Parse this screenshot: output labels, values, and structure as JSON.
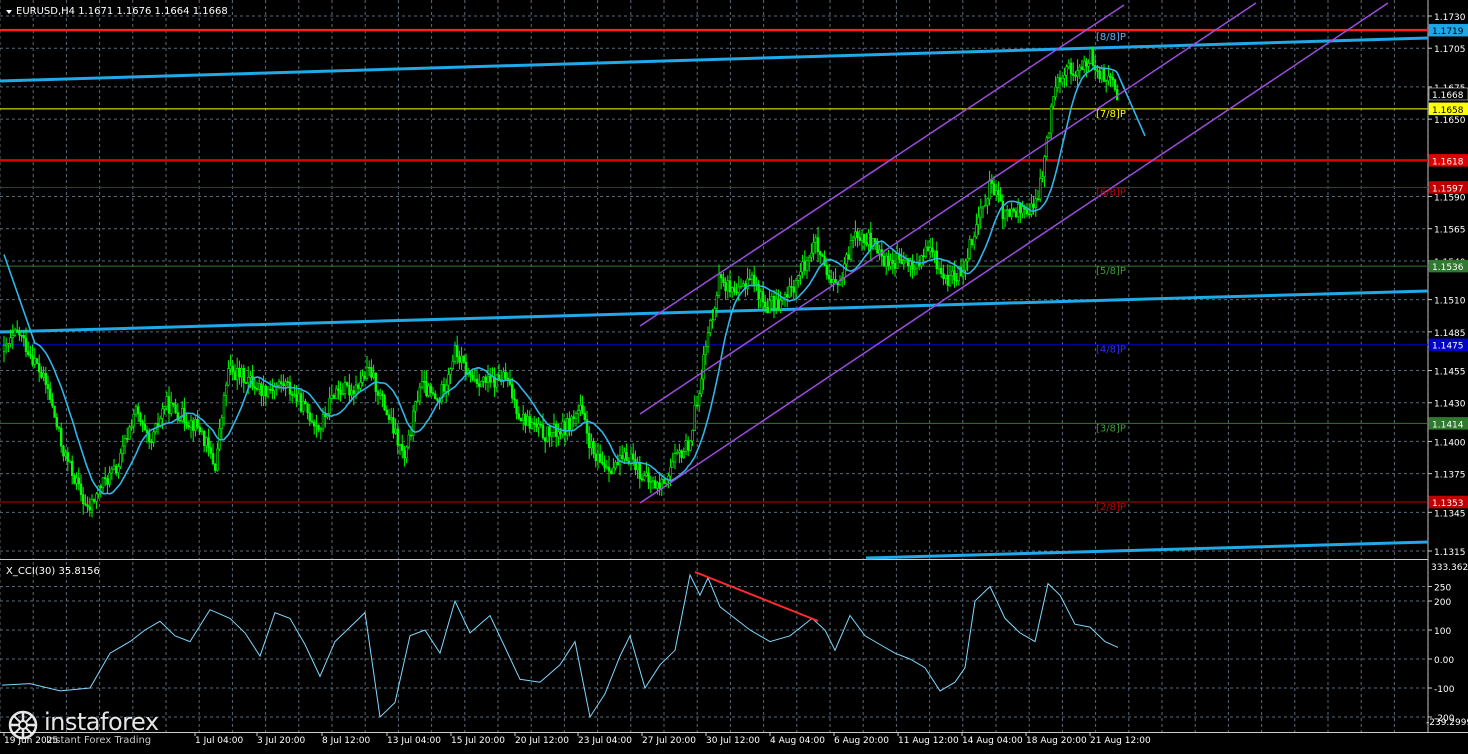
{
  "header": {
    "symbol_line": "EURUSD,H4  1.1671 1.1676 1.1664 1.1668"
  },
  "main_axis": {
    "min": 1.13,
    "max": 1.175,
    "ticks": [
      "1.1730",
      "1.1705",
      "1.1675",
      "1.1650",
      "1.1590",
      "1.1565",
      "1.1540",
      "1.1510",
      "1.1485",
      "1.1455",
      "1.1430",
      "1.1400",
      "1.1375",
      "1.1345",
      "1.1315"
    ]
  },
  "price_tags": [
    {
      "label": "1.1719",
      "value": 1.1719,
      "bg": "#1ea7e8",
      "fg": "#000000"
    },
    {
      "label": "1.1668",
      "value": 1.16695,
      "bg": "#000000",
      "fg": "#ffffff"
    },
    {
      "label": "1.1658",
      "value": 1.1658,
      "bg": "#ffff00",
      "fg": "#000000"
    },
    {
      "label": "1.1618",
      "value": 1.1618,
      "bg": "#e00000",
      "fg": "#ffffff"
    },
    {
      "label": "1.1597",
      "value": 1.1597,
      "bg": "#c00000",
      "fg": "#ffffff"
    },
    {
      "label": "1.1536",
      "value": 1.1536,
      "bg": "#2f7a2f",
      "fg": "#ffffff"
    },
    {
      "label": "1.1475",
      "value": 1.1475,
      "bg": "#0000cc",
      "fg": "#ffffff"
    },
    {
      "label": "1.1414",
      "value": 1.1414,
      "bg": "#2f7a2f",
      "fg": "#ffffff"
    },
    {
      "label": "1.1353",
      "value": 1.1353,
      "bg": "#c00000",
      "fg": "#ffffff"
    }
  ],
  "murrey_labels": [
    {
      "label": "[8/8]P",
      "value": 1.1719,
      "color": "#5ab0ff"
    },
    {
      "label": "[7/8]P",
      "value": 1.1658,
      "color": "#ffff00"
    },
    {
      "label": "[6/8]P",
      "value": 1.1597,
      "color": "#c00000"
    },
    {
      "label": "[5/8]P",
      "value": 1.1536,
      "color": "#3c9c3c"
    },
    {
      "label": "[4/8]P",
      "value": 1.1475,
      "color": "#3030ff"
    },
    {
      "label": "[3/8]P",
      "value": 1.1414,
      "color": "#3c9c3c"
    },
    {
      "label": "[2/8]P",
      "value": 1.1353,
      "color": "#c00000"
    }
  ],
  "x_axis": {
    "labels": [
      "19 Jun 2025",
      "1 Jul 04:00",
      "3 Jul 20:00",
      "8 Jul 12:00",
      "13 Jul 04:00",
      "15 Jul 20:00",
      "20 Jul 12:00",
      "23 Jul 04:00",
      "27 Jul 20:00",
      "30 Jul 12:00",
      "4 Aug 04:00",
      "6 Aug 20:00",
      "11 Aug 12:00",
      "14 Aug 04:00",
      "18 Aug 20:00",
      "21 Aug 12:00"
    ]
  },
  "cci": {
    "title": "X_CCI(30) 35.8156",
    "axis_top": "333.3621",
    "axis_bottom": "-239.2999",
    "ticks": [
      "250",
      "200",
      "100",
      "0.00",
      "-100",
      "-200"
    ]
  },
  "logo": {
    "brand": "instaforex",
    "tagline": "Instant Forex Trading"
  },
  "colors": {
    "candle": "#00ff00",
    "grid": "#5a6a7a",
    "ma": "#2fb5e8",
    "cci": "#7fd8ff",
    "trend": "#1fa9e8",
    "channel": "#9c4de0",
    "divergence": "#ff2a2a"
  }
}
